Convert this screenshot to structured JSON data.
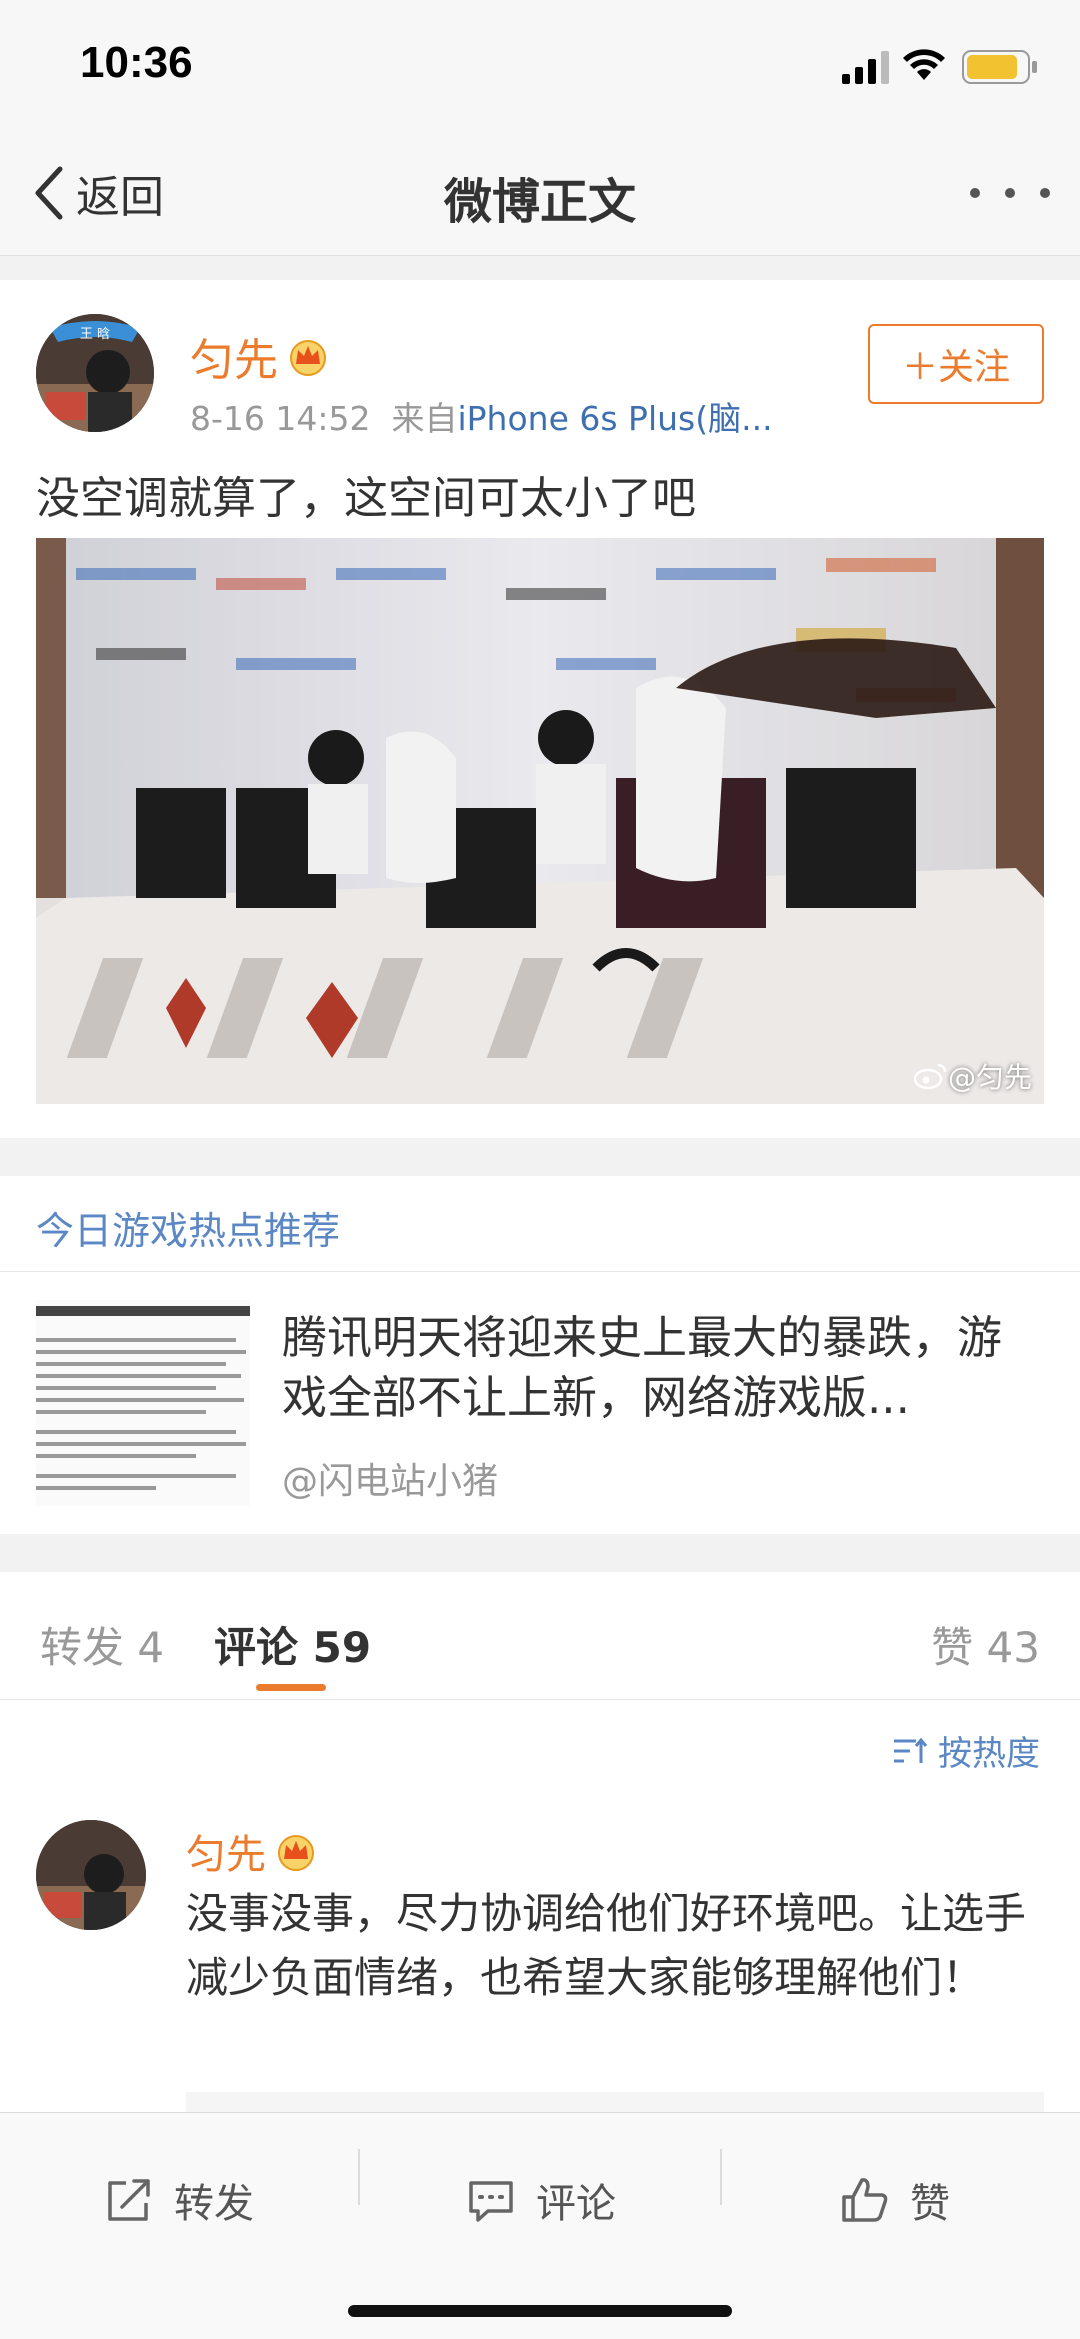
{
  "status_bar": {
    "time": "10:36"
  },
  "nav": {
    "back_label": "返回",
    "title": "微博正文"
  },
  "post": {
    "user": "匀先",
    "timestamp": "8-16 14:52",
    "source_prefix": "来自",
    "source": "iPhone 6s Plus(脑...",
    "follow_label": "＋关注",
    "text": "没空调就算了，这空间可太小了吧",
    "watermark": "@匀先",
    "avatar_badge": "王 晗"
  },
  "recommendation": {
    "section_title": "今日游戏热点推荐",
    "headline": "腾讯明天将迎来史上最大的暴跌，游戏全部不让上新，网络游戏版...",
    "source": "@闪电站小猪"
  },
  "tabs": {
    "repost_label": "转发",
    "repost_count": "4",
    "comment_label": "评论",
    "comment_count": "59",
    "like_label": "赞",
    "like_count": "43"
  },
  "comments": {
    "sort_label": "按热度",
    "items": [
      {
        "user": "匀先",
        "text": "没事没事，尽力协调给他们好环境吧。让选手减少负面情绪，也希望大家能够理解他们！"
      }
    ]
  },
  "bottom_bar": {
    "repost": "转发",
    "comment": "评论",
    "like": "赞"
  },
  "colors": {
    "accent": "#eb7b2d",
    "link": "#5b87c4",
    "source_link": "#3e6fb0"
  }
}
